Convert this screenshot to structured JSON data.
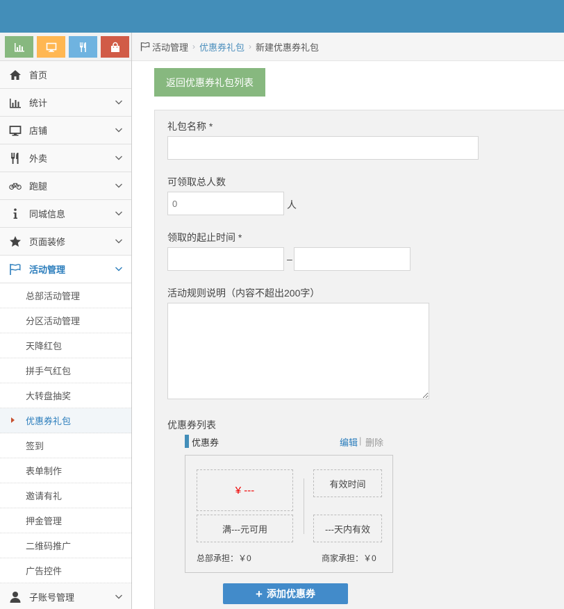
{
  "colors": {
    "topbar": "#438eb9",
    "btn_green": "#87b87f",
    "btn_orange": "#ffb752",
    "btn_blue": "#6fb3e0",
    "btn_red": "#d15b47",
    "link": "#2b7dbc",
    "primary": "#428bca",
    "price": "#ee0000"
  },
  "shortcuts": [
    {
      "icon": "bar-chart-icon"
    },
    {
      "icon": "desktop-icon"
    },
    {
      "icon": "utensils-icon"
    },
    {
      "icon": "shopping-bag-icon"
    }
  ],
  "sidebar": {
    "items": [
      {
        "label": "首页",
        "icon": "home-icon"
      },
      {
        "label": "统计",
        "icon": "bar-chart-icon"
      },
      {
        "label": "店铺",
        "icon": "desktop-icon"
      },
      {
        "label": "外卖",
        "icon": "utensils-icon"
      },
      {
        "label": "跑腿",
        "icon": "bicycle-icon"
      },
      {
        "label": "同城信息",
        "icon": "info-icon"
      },
      {
        "label": "页面装修",
        "icon": "star-icon"
      },
      {
        "label": "活动管理",
        "icon": "flag-icon"
      }
    ],
    "sub_items": [
      "总部活动管理",
      "分区活动管理",
      "天降红包",
      "拼手气红包",
      "大转盘抽奖",
      "优惠券礼包",
      "签到",
      "表单制作",
      "邀请有礼",
      "押金管理",
      "二维码推广",
      "广告控件"
    ],
    "last_item": {
      "label": "子账号管理",
      "icon": "user-icon"
    }
  },
  "breadcrumb": {
    "root": "活动管理",
    "parent": "优惠券礼包",
    "current": "新建优惠券礼包"
  },
  "page": {
    "back_button": "返回优惠券礼包列表"
  },
  "form": {
    "gift_name_label": "礼包名称 *",
    "gift_name_value": "",
    "total_people_label": "可领取总人数",
    "total_people_placeholder": "0",
    "total_people_unit": "人",
    "time_range_label": "领取的起止时间 *",
    "time_range_sep": "–",
    "rules_label": "活动规则说明（内容不超出200字）",
    "coupon_list_label": "优惠券列表",
    "coupon_title": "优惠券",
    "edit": "编辑",
    "divider": "|",
    "delete": "删除",
    "coupon": {
      "price": "¥ ---",
      "condition": "满---元可用",
      "validity_label": "有效时间",
      "validity_value": "---天内有效",
      "hq_share": "总部承担：￥0",
      "merchant_share": "商家承担：￥0"
    },
    "add_coupon_button": "添加优惠券"
  }
}
